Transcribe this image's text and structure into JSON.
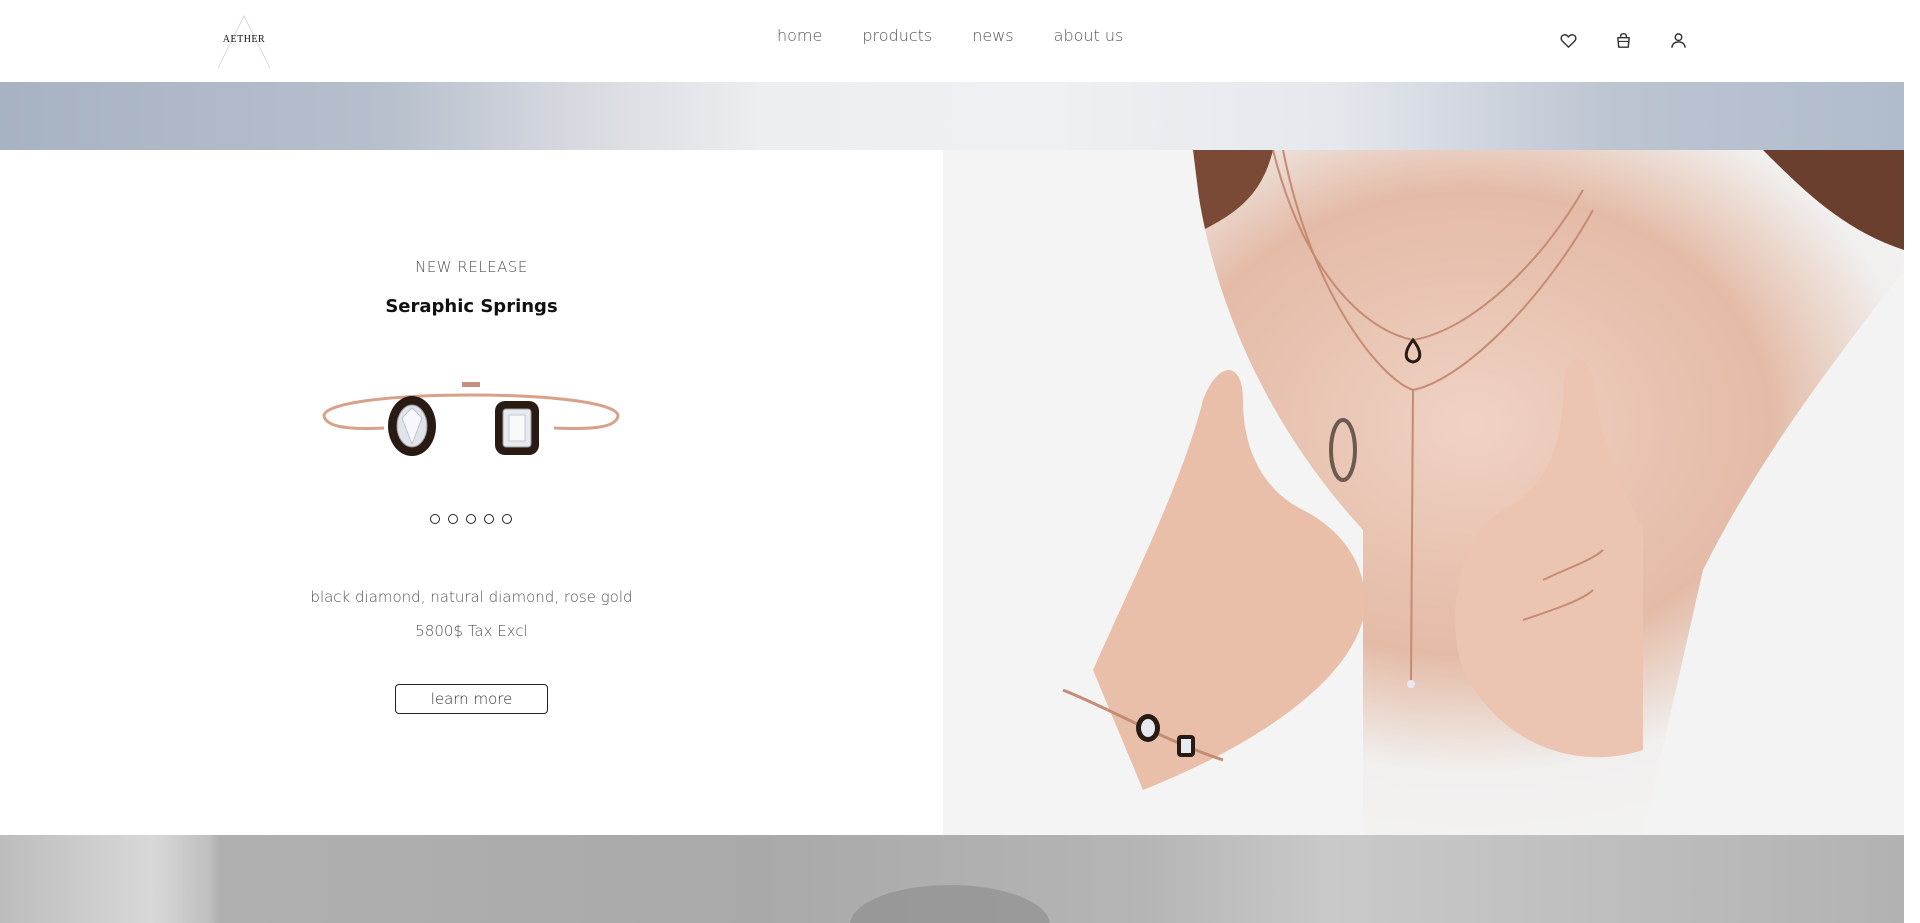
{
  "brand": {
    "logo_text": "AETHER"
  },
  "nav": {
    "items": [
      {
        "label": "home"
      },
      {
        "label": "products"
      },
      {
        "label": "news"
      },
      {
        "label": "about us"
      }
    ]
  },
  "header_icons": [
    "heart-icon",
    "bag-icon",
    "user-icon"
  ],
  "product": {
    "eyebrow": "NEW RELEASE",
    "title": "Seraphic Springs",
    "carousel_dots": 5,
    "materials": "black diamond, natural diamond, rose gold",
    "price": "5800$ Tax Excl",
    "cta_label": "learn more"
  },
  "colors": {
    "accent": "#222222",
    "rose_gold": "#d9a08a"
  }
}
